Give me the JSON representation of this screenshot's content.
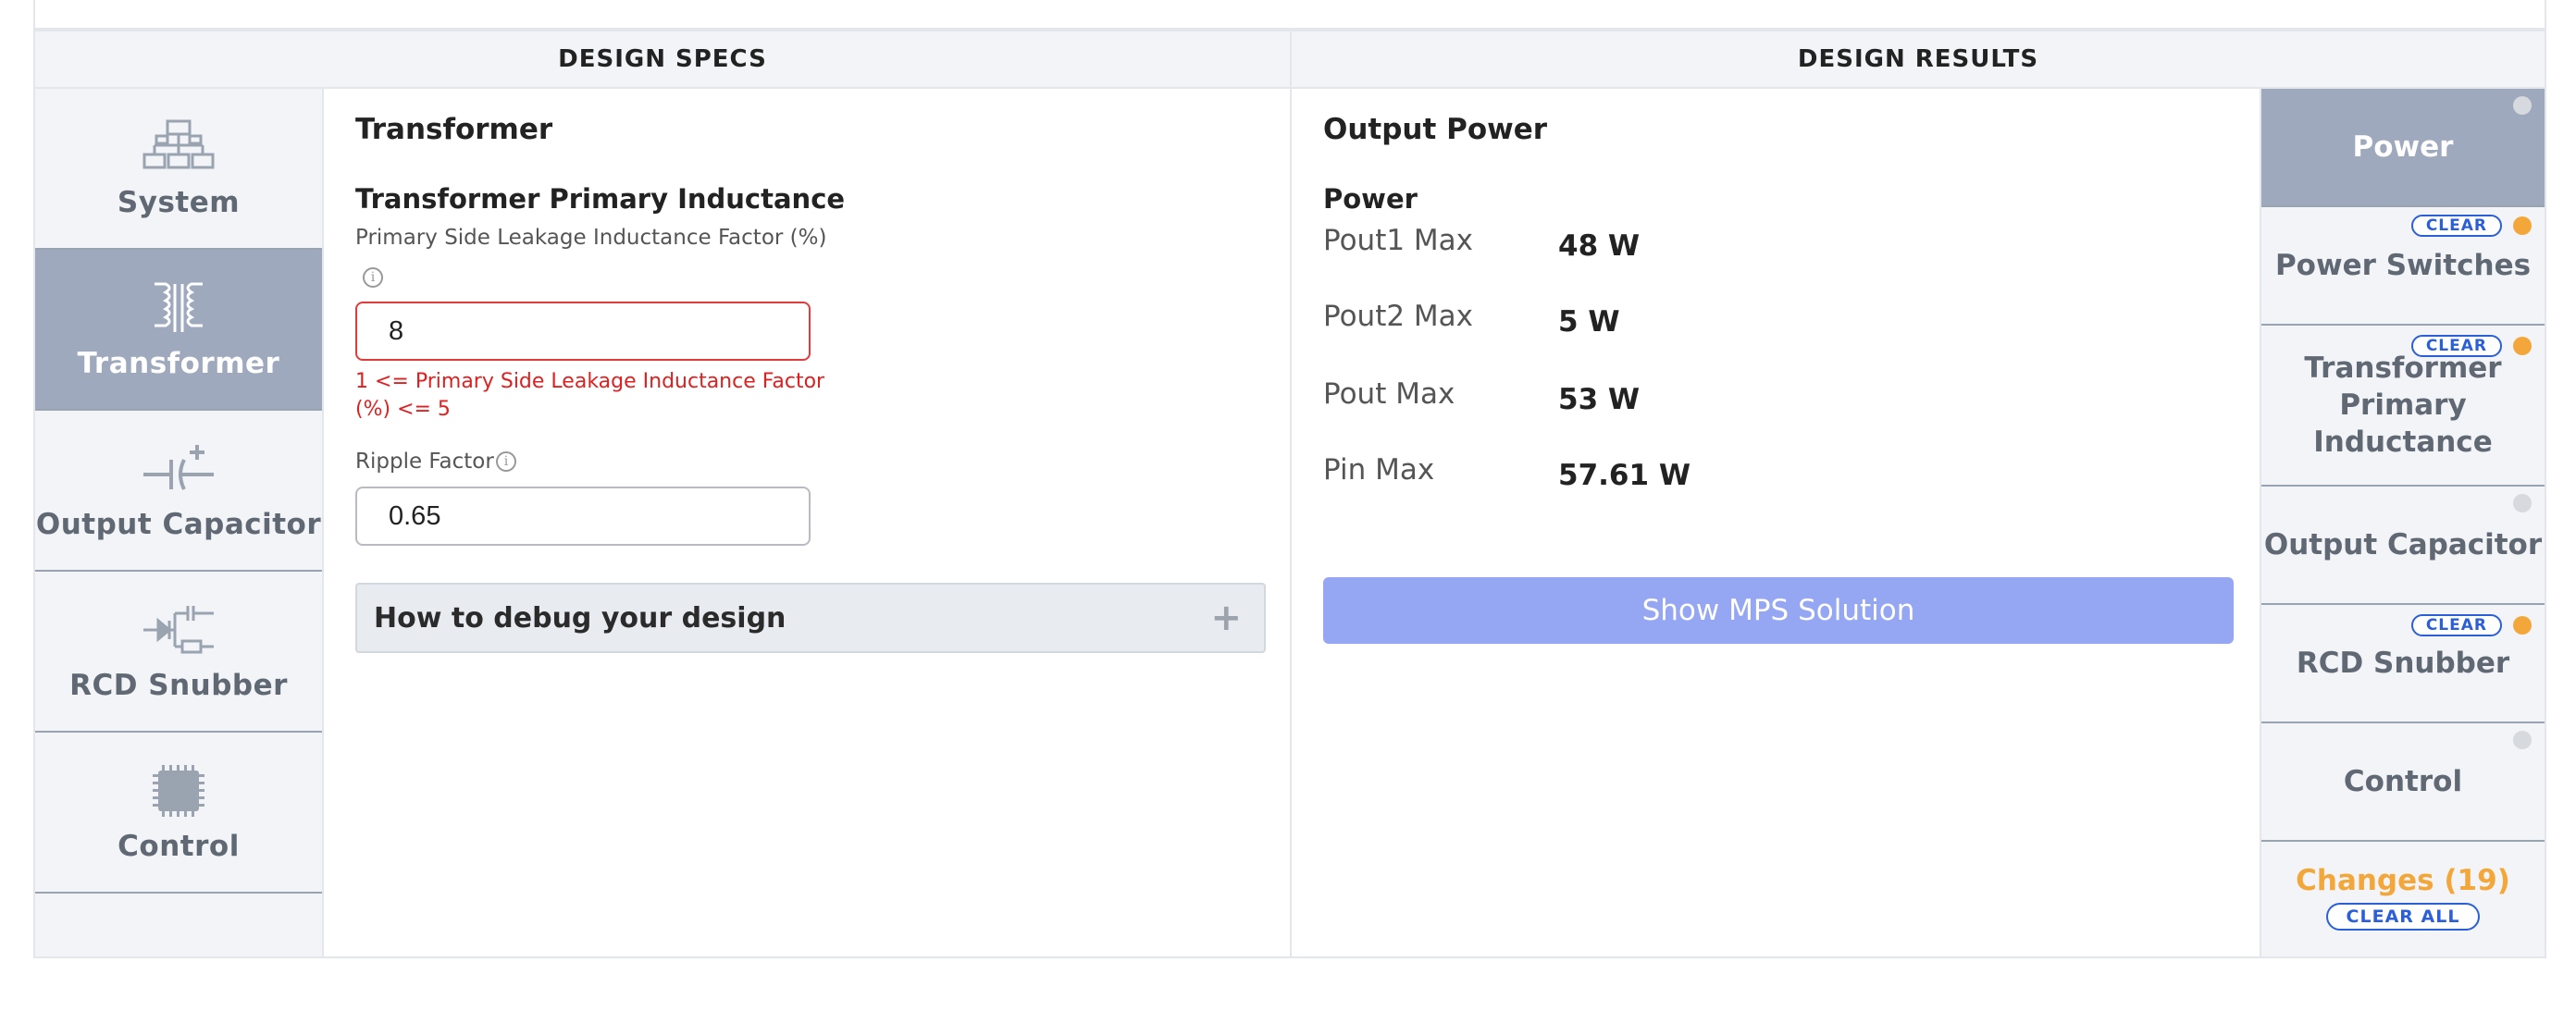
{
  "headers": {
    "specs": "DESIGN SPECS",
    "results": "DESIGN RESULTS"
  },
  "left_nav": [
    {
      "label": "System",
      "icon": "system-hierarchy-icon",
      "active": false
    },
    {
      "label": "Transformer",
      "icon": "transformer-icon",
      "active": true
    },
    {
      "label": "Output Capacitor",
      "icon": "capacitor-icon",
      "active": false
    },
    {
      "label": "RCD Snubber",
      "icon": "rcd-snubber-icon",
      "active": false
    },
    {
      "label": "Control",
      "icon": "chip-icon",
      "active": false
    }
  ],
  "specs": {
    "section_title": "Transformer",
    "subsection_title": "Transformer Primary Inductance",
    "leakage": {
      "label": "Primary Side Leakage Inductance Factor (%)",
      "value": "8",
      "error": "1 <= Primary Side Leakage Inductance Factor (%) <= 5"
    },
    "ripple": {
      "label": "Ripple Factor",
      "value": "0.65"
    },
    "debug_accordion": "How to debug your design",
    "accordion_symbol": "+"
  },
  "results": {
    "section_title": "Output Power",
    "subsection_title": "Power",
    "rows": [
      {
        "label": "Pout1 Max",
        "value": "48 W"
      },
      {
        "label": "Pout2 Max",
        "value": "5 W"
      },
      {
        "label": "Pout Max",
        "value": "53 W"
      },
      {
        "label": "Pin Max",
        "value": "57.61 W"
      }
    ],
    "button_label": "Show MPS Solution"
  },
  "right_nav": [
    {
      "label": "Power",
      "active": true,
      "status": "grey",
      "clear": false
    },
    {
      "label": "Power Switches",
      "active": false,
      "status": "orange",
      "clear": true
    },
    {
      "label": "Transformer Primary Inductance",
      "active": false,
      "status": "orange",
      "clear": true
    },
    {
      "label": "Output Capacitor",
      "active": false,
      "status": "grey",
      "clear": false
    },
    {
      "label": "RCD Snubber",
      "active": false,
      "status": "orange",
      "clear": true
    },
    {
      "label": "Control",
      "active": false,
      "status": "grey",
      "clear": false
    }
  ],
  "clear_label": "CLEAR",
  "changes": {
    "label": "Changes (19)",
    "clear_all_label": "CLEAR ALL"
  },
  "colors": {
    "accent_active": "#9ea9bd",
    "error": "#e02020",
    "button": "#95a6f2",
    "pending": "#f3a73a",
    "link": "#2b5fd9"
  }
}
